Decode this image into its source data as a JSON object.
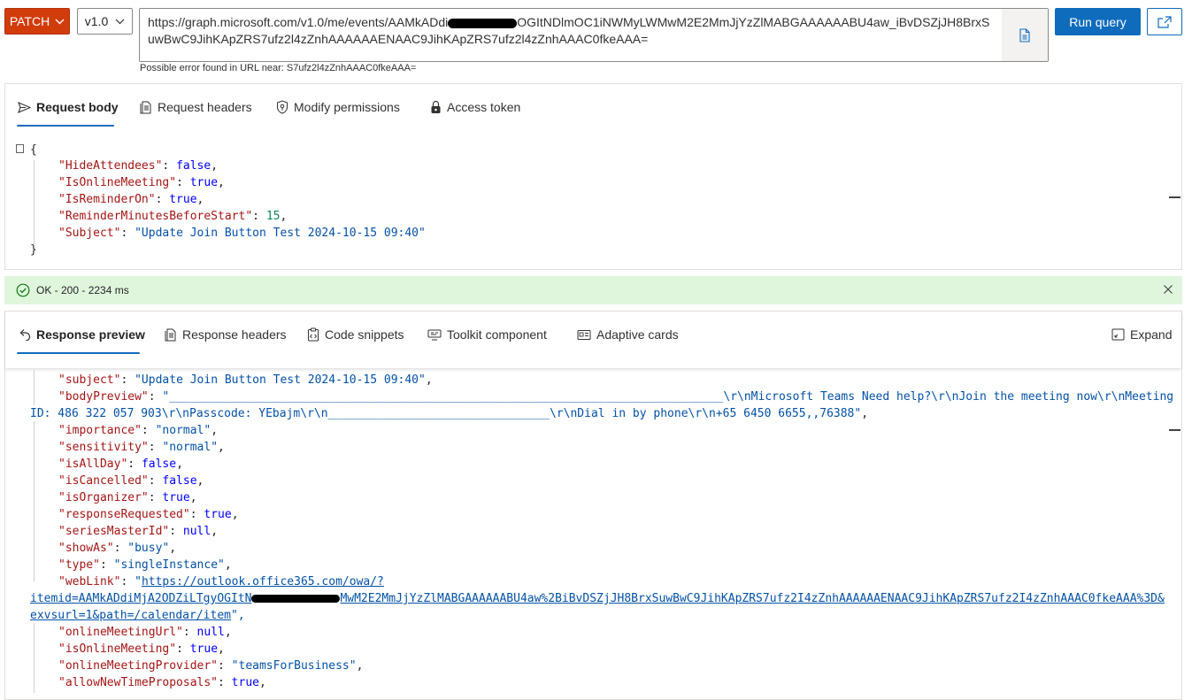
{
  "toolbar": {
    "method": "PATCH",
    "version": "v1.0",
    "url_part1": "https://graph.microsoft.com/v1.0/me/events/AAMkADdi",
    "url_part2": "OGItNDlmOC1iNWMyLWMwM2E2MmJjYzZlMABGAAAAAABU4aw_iBvDSZjJH8BrxSuwBwC9JihKApZRS7ufz2l4zZnhAAAAAAENAAC9JihKApZRS7ufz2l4zZnhAAAC0fkeAAA=",
    "url_error": "Possible error found in URL near: S7ufz2l4zZnhAAAC0fkeAAA=",
    "run_label": "Run query",
    "icons": {
      "method_chevron": "chevron-down-icon",
      "version_chevron": "chevron-down-icon",
      "doc": "document-icon",
      "share": "share-icon"
    }
  },
  "request": {
    "tabs": [
      {
        "label": "Request body",
        "icon": "send-icon",
        "active": true
      },
      {
        "label": "Request headers",
        "icon": "headers-icon",
        "active": false
      },
      {
        "label": "Modify permissions",
        "icon": "shield-key-icon",
        "active": false
      },
      {
        "label": "Access token",
        "icon": "lock-icon",
        "active": false
      }
    ],
    "body": {
      "open": "{",
      "close": "}",
      "lines": [
        {
          "key": "\"HideAttendees\"",
          "val": "false",
          "type": "bool",
          "comma": ","
        },
        {
          "key": "\"IsOnlineMeeting\"",
          "val": "true",
          "type": "bool",
          "comma": ","
        },
        {
          "key": "\"IsReminderOn\"",
          "val": "true",
          "type": "bool",
          "comma": ","
        },
        {
          "key": "\"ReminderMinutesBeforeStart\"",
          "val": "15",
          "type": "num",
          "comma": ","
        },
        {
          "key": "\"Subject\"",
          "val": "\"Update Join Button Test 2024-10-15 09:40\"",
          "type": "str",
          "comma": ""
        }
      ]
    }
  },
  "status": {
    "text": "OK - 200 - 2234 ms",
    "color": "#dff6dd"
  },
  "response": {
    "tabs": [
      {
        "label": "Response preview",
        "icon": "undo-arrow-icon",
        "active": true
      },
      {
        "label": "Response headers",
        "icon": "headers-icon",
        "active": false
      },
      {
        "label": "Code snippets",
        "icon": "clipboard-code-icon",
        "active": false
      },
      {
        "label": "Toolkit component",
        "icon": "toolkit-icon",
        "active": false
      },
      {
        "label": "Adaptive cards",
        "icon": "card-icon",
        "active": false
      }
    ],
    "expand_label": "Expand",
    "subject": {
      "key": "\"subject\"",
      "val": "\"Update Join Button Test 2024-10-15 09:40\""
    },
    "bodyPreview": {
      "key": "\"bodyPreview\"",
      "val_line1": "\"________________________________________________________________________________\\r\\nMicrosoft Teams Need help?\\r\\nJoin the meeting now\\r\\nMeeting",
      "val_line2": "ID: 486 322 057 903\\r\\nPasscode: YEbajm\\r\\n________________________________\\r\\nDial in by phone\\r\\n+65 6450 6655,,76388\""
    },
    "fields": [
      {
        "key": "\"importance\"",
        "val": "\"normal\"",
        "type": "str"
      },
      {
        "key": "\"sensitivity\"",
        "val": "\"normal\"",
        "type": "str"
      },
      {
        "key": "\"isAllDay\"",
        "val": "false",
        "type": "bool"
      },
      {
        "key": "\"isCancelled\"",
        "val": "false",
        "type": "bool"
      },
      {
        "key": "\"isOrganizer\"",
        "val": "true",
        "type": "bool"
      },
      {
        "key": "\"responseRequested\"",
        "val": "true",
        "type": "bool"
      },
      {
        "key": "\"seriesMasterId\"",
        "val": "null",
        "type": "bool"
      },
      {
        "key": "\"showAs\"",
        "val": "\"busy\"",
        "type": "str"
      },
      {
        "key": "\"type\"",
        "val": "\"singleInstance\"",
        "type": "str"
      }
    ],
    "webLink": {
      "key": "\"webLink\"",
      "quote": "\"",
      "line1": "https://outlook.office365.com/owa/?",
      "line2a": "itemid=AAMkADdiMjA2ODZiLTgyOGItN",
      "line2b": "MwM2E2MmJjYzZlMABGAAAAAABU4aw%2BiBvDSZjJH8BrxSuwBwC9JihKApZRS7ufz2I4zZnhAAAAAAENAAC9JihKApZRS7ufz2I4zZnhAAAC0fkeAAA%3D&",
      "line3": "exvsurl=1&path=/calendar/item",
      "end": "\","
    },
    "fields2": [
      {
        "key": "\"onlineMeetingUrl\"",
        "val": "null",
        "type": "bool"
      },
      {
        "key": "\"isOnlineMeeting\"",
        "val": "true",
        "type": "bool"
      },
      {
        "key": "\"onlineMeetingProvider\"",
        "val": "\"teamsForBusiness\"",
        "type": "str"
      },
      {
        "key": "\"allowNewTimeProposals\"",
        "val": "true",
        "type": "bool"
      }
    ]
  }
}
